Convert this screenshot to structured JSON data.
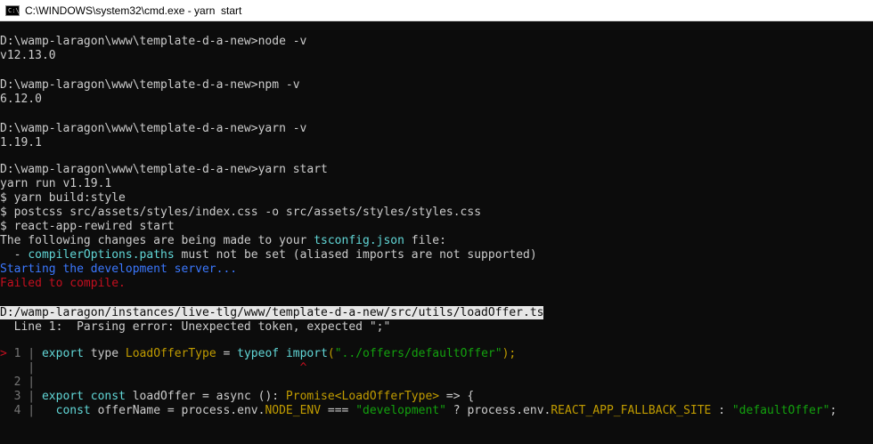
{
  "window": {
    "title": "C:\\WINDOWS\\system32\\cmd.exe - yarn  start",
    "icon": "cmd-icon",
    "icon_glyph": "C:\\"
  },
  "colors": {
    "background": "#0c0c0c",
    "text": "#cccccc",
    "cyan": "#61d6d6",
    "blue": "#3b78ff",
    "red": "#c50f1f",
    "yellow": "#c19c00",
    "magenta": "#b4009e",
    "green": "#13a10e",
    "gray": "#767676",
    "highlight": "#e6e6e6"
  },
  "console": {
    "cmd_node": "D:\\wamp-laragon\\www\\template-d-a-new>node -v",
    "out_node": "v12.13.0",
    "cmd_npm": "D:\\wamp-laragon\\www\\template-d-a-new>npm -v",
    "out_npm": "6.12.0",
    "cmd_yarn": "D:\\wamp-laragon\\www\\template-d-a-new>yarn -v",
    "out_yarn": "1.19.1",
    "cmd_start": "D:\\wamp-laragon\\www\\template-d-a-new>yarn start",
    "yarn_run": "yarn run v1.19.1",
    "step_build_style": "$ yarn build:style",
    "step_postcss": "$ postcss src/assets/styles/index.css -o src/assets/styles/styles.css",
    "step_rewired": "$ react-app-rewired start",
    "tsconfig_line": {
      "before": "The following changes are being made to your ",
      "file": "tsconfig.json",
      "after": " file:"
    },
    "compiler_line": {
      "prefix": "  - ",
      "option": "compilerOptions.paths",
      "after": " must not be set (aliased imports are not supported)"
    },
    "starting": "Starting the development server...",
    "failed": "Failed to compile.",
    "error_file": "D:/wamp-laragon/instances/live-tlg/www/template-d-a-new/src/utils/loadOffer.ts",
    "error_message": "  Line 1:  Parsing error: Unexpected token, expected \";\"",
    "code_frame": {
      "line1": {
        "marker": "> ",
        "num": "1",
        "sep": " | ",
        "code_export": "export",
        "code_type": " type ",
        "code_name": "LoadOfferType",
        "code_eq": " = ",
        "code_typeof": "typeof",
        "code_sp": " ",
        "code_import": "import",
        "code_lp": "(",
        "code_str": "\"../offers/defaultOffer\"",
        "code_end": ");"
      },
      "caret_line": {
        "pad": "    | ",
        "spaces": "                                     ",
        "caret": "^"
      },
      "line2": {
        "num": "  2",
        "sep": " |"
      },
      "line3": {
        "num": "  3",
        "sep": " | ",
        "kw_export": "export",
        "kw_const": " const",
        "name": " loadOffer = async (): ",
        "promise": "Promise<LoadOfferType>",
        "arrow": " => {"
      },
      "line4": {
        "num": "  4",
        "sep": " |   ",
        "kw_const": "const",
        "decl": " offerName = process.env.",
        "env1": "NODE_ENV",
        "eqeq": " === ",
        "str1": "\"development\"",
        "q": " ? ",
        "proc": "process.env.",
        "env2": "REACT_APP_FALLBACK_SITE",
        "colon": " : ",
        "str2": "\"defaultOffer\"",
        "semi": ";"
      }
    }
  }
}
